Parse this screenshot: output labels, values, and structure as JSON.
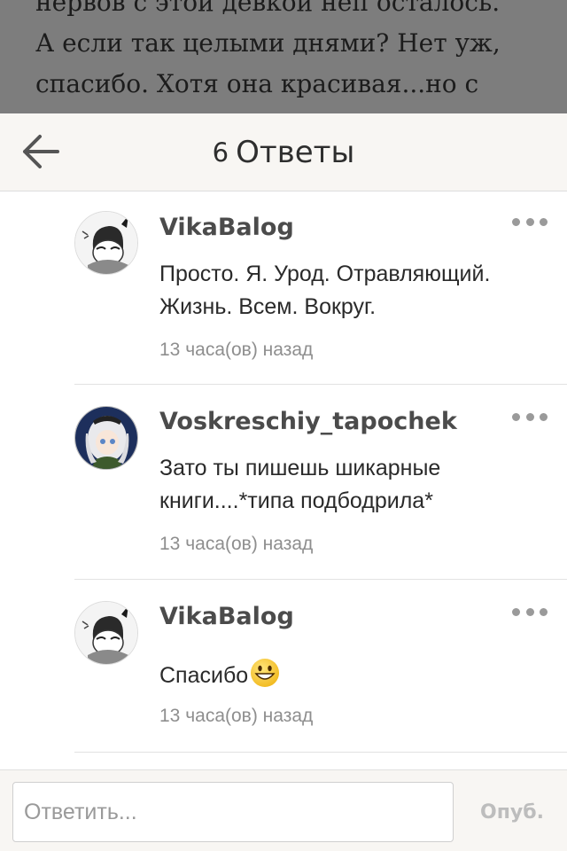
{
  "background_story": {
    "lines": [
      "нервов с этой девкой неп осталось.",
      "А если так целыми днями? Нет уж,",
      "спасибо. Хотя она красивая...но с"
    ]
  },
  "header": {
    "reply_count": "6",
    "title": "Ответы",
    "back_icon": "arrow-left-icon"
  },
  "replies": [
    {
      "username": "VikaBalog",
      "text": "Просто. Я. Урод. Отравляющий. Жизнь. Всем. Вокруг.",
      "time": "13 часа(ов) назад",
      "avatar": "avatar-manga-dark-hair"
    },
    {
      "username": "Voskreschiy_tapochek",
      "text": "Зато ты пишешь шикарные книги....*типа подбодрила*",
      "time": "13 часа(ов) назад",
      "avatar": "avatar-anime-white-hair"
    },
    {
      "username": "VikaBalog",
      "text": "Спасибо",
      "emoji": "grinning-face-icon",
      "time": "13 часа(ов) назад",
      "avatar": "avatar-manga-dark-hair"
    }
  ],
  "footer": {
    "input_placeholder": "Ответить...",
    "post_label": "Опуб."
  },
  "colors": {
    "header_bg": "#f8f6f3",
    "dim_overlay": "#7d7d7d",
    "username": "#4b4b4b",
    "timestamp": "#8e8e8e",
    "post_disabled": "#bdbdbd"
  }
}
